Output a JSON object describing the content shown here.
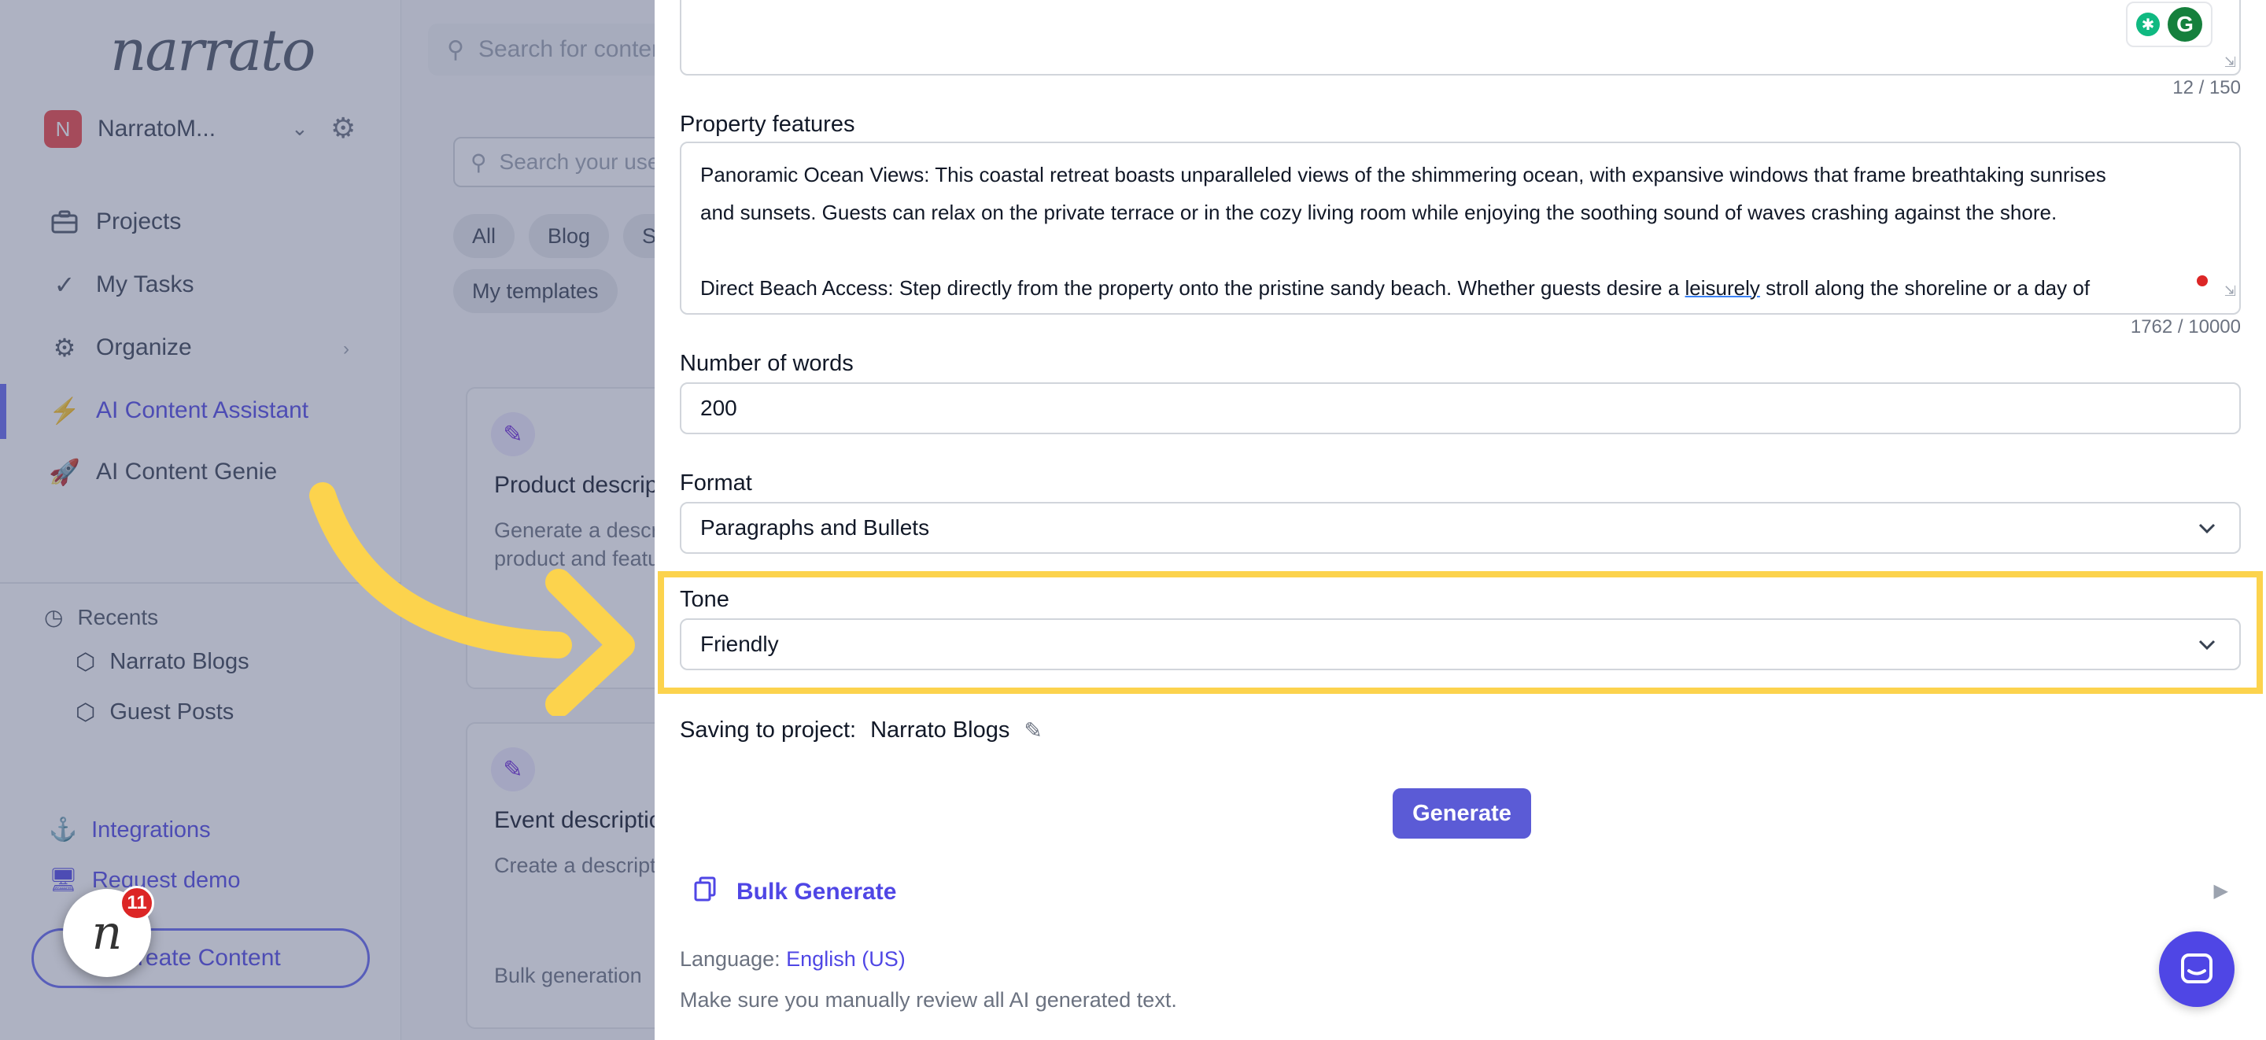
{
  "sidebar": {
    "logo": "narrato",
    "workspace": {
      "initial": "N",
      "name": "NarratoM..."
    },
    "nav": [
      {
        "label": "Projects",
        "icon": "briefcase-icon"
      },
      {
        "label": "My Tasks",
        "icon": "checkmark-icon"
      },
      {
        "label": "Organize",
        "icon": "gears-icon"
      },
      {
        "label": "AI Content Assistant",
        "icon": "lightning-icon"
      },
      {
        "label": "AI Content Genie",
        "icon": "rocket-icon"
      }
    ],
    "recents_label": "Recents",
    "recents": [
      "Narrato Blogs",
      "Guest Posts"
    ],
    "links": [
      "Integrations",
      "Request demo"
    ],
    "create_label": "Create Content",
    "notification_count": "11"
  },
  "middle": {
    "search_placeholder": "Search for content",
    "template_search_placeholder": "Search your use cases",
    "chips": [
      "All",
      "Blog",
      "Social",
      "My templates"
    ],
    "cards": [
      {
        "title": "Product description",
        "desc1": "Generate a description",
        "desc2": "product and features"
      },
      {
        "title": "Event description",
        "desc1": "Create a description",
        "desc2": "Bulk generation"
      }
    ]
  },
  "form": {
    "top_counter": "12 / 150",
    "property_features_label": "Property features",
    "property_features_lines": [
      "Panoramic Ocean Views: This coastal retreat boasts unparalleled views of the shimmering ocean, with expansive windows that frame breathtaking sunrises",
      "and sunsets. Guests can relax on the private terrace or in the cozy living room while enjoying the soothing sound of waves crashing against the shore.",
      "",
      "Direct Beach Access: Step directly from the property onto the pristine sandy beach. Whether guests desire a ",
      "leisurely",
      " stroll along the shoreline or a day of"
    ],
    "features_counter": "1762 / 10000",
    "words_label": "Number of words",
    "words_value": "200",
    "format_label": "Format",
    "format_value": "Paragraphs and Bullets",
    "tone_label": "Tone",
    "tone_value": "Friendly",
    "saving_label": "Saving to project:",
    "saving_project": "Narrato Blogs",
    "generate_label": "Generate",
    "bulk_label": "Bulk Generate",
    "language_label": "Language:",
    "language_value": "English (US)",
    "review_note": "Make sure you manually review all AI generated text."
  },
  "colors": {
    "accent": "#5b5bd6",
    "highlight": "#fcd34d",
    "arrow": "#fcd34d"
  }
}
